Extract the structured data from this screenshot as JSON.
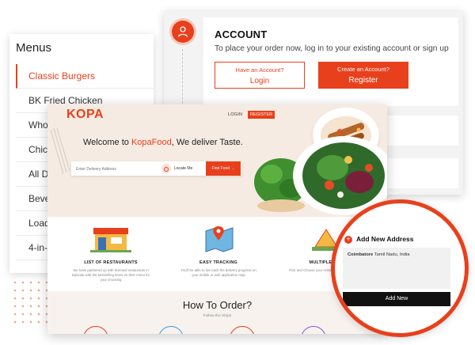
{
  "account": {
    "title": "ACCOUNT",
    "subtitle": "To place your order now, log in to your existing account or sign up",
    "login_prompt": "Have an Account?",
    "login_label": "Login",
    "register_prompt": "Create an Account?",
    "register_label": "Register"
  },
  "menus": {
    "title": "Menus",
    "items": [
      {
        "label": "Classic Burgers",
        "active": true
      },
      {
        "label": "BK Fried Chicken"
      },
      {
        "label": "Whop"
      },
      {
        "label": "Chic"
      },
      {
        "label": "All D"
      },
      {
        "label": "Beve"
      },
      {
        "label": "Load"
      },
      {
        "label": "4-in-"
      }
    ]
  },
  "site": {
    "logo": "KOPA",
    "nav": {
      "login": "LOGIN",
      "register": "REGISTER"
    },
    "welcome_prefix": "Welcome to ",
    "welcome_brand": "KopaFood",
    "welcome_suffix": ", We deliver Taste.",
    "search_placeholder": "Enter Delivery Address",
    "locate_label": "Locate Me",
    "find_button": "Find Food  →",
    "features": [
      {
        "title": "LIST OF RESTAURANTS",
        "desc": "We have partnered up with licensed restaurants in Episode with the bestselling items on their menu for your choosing"
      },
      {
        "title": "EASY TRACKING",
        "desc": "You'll be able to live track the delivery progress on your mobile or web application map"
      },
      {
        "title": "MULTIPLE FOO",
        "desc": "Pick and Choose your restaurants getting exactly"
      }
    ],
    "how_title": "How To Order?",
    "how_sub": "Follow the Steps"
  },
  "address": {
    "title": "Add New Address",
    "city": "Coimbatore",
    "region": "Tamil Nadu, India",
    "button": "Add New"
  },
  "colors": {
    "accent": "#e8401c",
    "dark": "#111111",
    "panel": "#f3f3f3"
  }
}
